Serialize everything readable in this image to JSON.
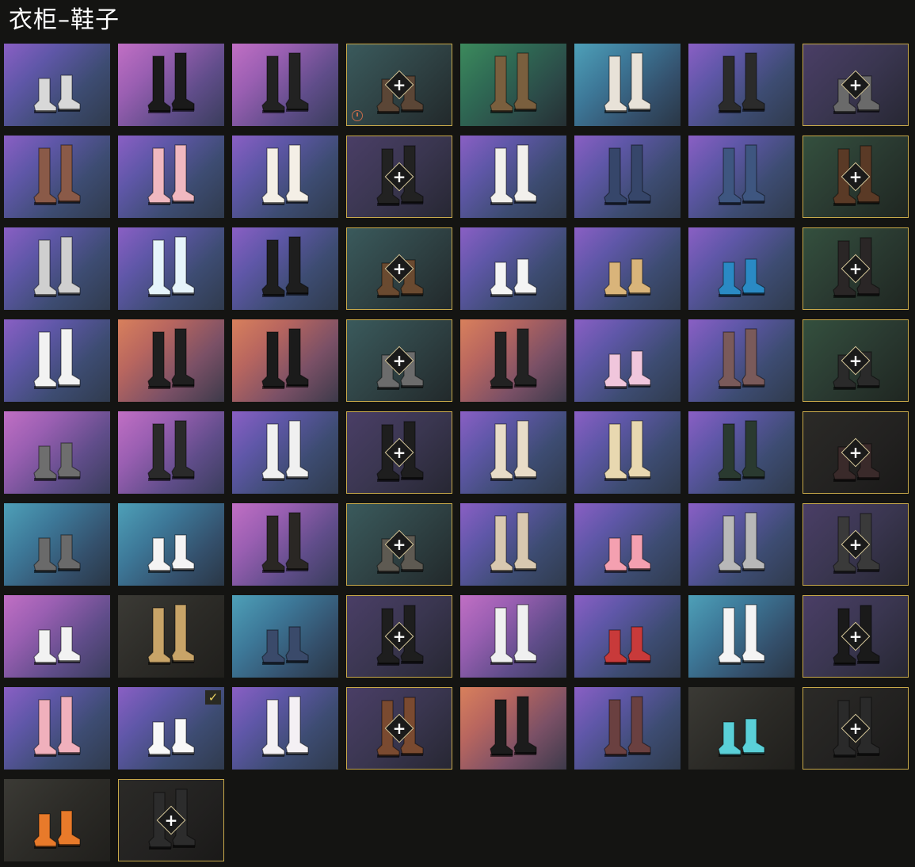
{
  "title": "衣柜–鞋子",
  "colors": {
    "locked_border": "#c8a94a",
    "background": "#141412"
  },
  "items": [
    {
      "bg": "purple",
      "shoe": "sneaker-white-red",
      "shoe_color": "#d8d8d8",
      "locked": false
    },
    {
      "bg": "pink",
      "shoe": "boots-black-yellow",
      "shoe_color": "#1a1a1a",
      "locked": false
    },
    {
      "bg": "pink",
      "shoe": "boots-black-neon",
      "shoe_color": "#222222",
      "locked": false
    },
    {
      "bg": "dim-teal",
      "shoe": "shoes-brown",
      "shoe_color": "#5b4636",
      "locked": true,
      "timed": true
    },
    {
      "bg": "green",
      "shoe": "boots-brown",
      "shoe_color": "#7a5f3e",
      "locked": false
    },
    {
      "bg": "teal",
      "shoe": "socks-loafers",
      "shoe_color": "#e8e2d8",
      "locked": false
    },
    {
      "bg": "purple",
      "shoe": "pants-cyan-shoes",
      "shoe_color": "#2b2b2b",
      "locked": false
    },
    {
      "bg": "dim-purple",
      "shoe": "sneakers-grey",
      "shoe_color": "#6a6a6a",
      "locked": true
    },
    {
      "bg": "purple",
      "shoe": "boots-brown-white",
      "shoe_color": "#8a5a48",
      "locked": false
    },
    {
      "bg": "purple",
      "shoe": "boots-pink-puffy",
      "shoe_color": "#f0b8c0",
      "locked": false
    },
    {
      "bg": "purple",
      "shoe": "socks-cream",
      "shoe_color": "#f4efe6",
      "locked": false
    },
    {
      "bg": "dim-purple",
      "shoe": "boots-black-tall",
      "shoe_color": "#222222",
      "locked": true
    },
    {
      "bg": "purple",
      "shoe": "socks-brown-shoes",
      "shoe_color": "#f2f0ec",
      "locked": false
    },
    {
      "bg": "purple",
      "shoe": "jeans-boots",
      "shoe_color": "#36466a",
      "locked": false
    },
    {
      "bg": "purple",
      "shoe": "jeans-boots",
      "shoe_color": "#3e5680",
      "locked": false
    },
    {
      "bg": "dim-green",
      "shoe": "pants-brown",
      "shoe_color": "#5a3a26",
      "locked": true
    },
    {
      "bg": "purple",
      "shoe": "boots-white-slouch",
      "shoe_color": "#cfcfcf",
      "locked": false
    },
    {
      "bg": "purple",
      "shoe": "boots-ice",
      "shoe_color": "#e6f4fb",
      "locked": false
    },
    {
      "bg": "purple",
      "shoe": "pants-black",
      "shoe_color": "#1e1e1e",
      "locked": false
    },
    {
      "bg": "dim-teal",
      "shoe": "shoes-brown-low",
      "shoe_color": "#6a4a30",
      "locked": true
    },
    {
      "bg": "purple",
      "shoe": "flats-white",
      "shoe_color": "#f4f4f4",
      "locked": false
    },
    {
      "bg": "purple",
      "shoe": "slippers-bear",
      "shoe_color": "#d9b47a",
      "locked": false
    },
    {
      "bg": "purple",
      "shoe": "sneakers-blue-green",
      "shoe_color": "#2a8ac4",
      "locked": false
    },
    {
      "bg": "dim-green",
      "shoe": "boots-dark",
      "shoe_color": "#2a2626",
      "locked": true
    },
    {
      "bg": "purple",
      "shoe": "heels-white-socks",
      "shoe_color": "#f2f2f2",
      "locked": false
    },
    {
      "bg": "orange",
      "shoe": "boots-black-heel",
      "shoe_color": "#1f1f1f",
      "locked": false
    },
    {
      "bg": "orange",
      "shoe": "boots-black-tall",
      "shoe_color": "#1b1b1b",
      "locked": false
    },
    {
      "bg": "dim-teal",
      "shoe": "shoes-grey",
      "shoe_color": "#6c6c6c",
      "locked": true
    },
    {
      "bg": "orange",
      "shoe": "boots-black-strap",
      "shoe_color": "#222222",
      "locked": false
    },
    {
      "bg": "purple",
      "shoe": "sneakers-pink",
      "shoe_color": "#f0c6dc",
      "locked": false
    },
    {
      "bg": "purple",
      "shoe": "stockings-fishnet",
      "shoe_color": "#7a5a5a",
      "locked": false
    },
    {
      "bg": "dim-green",
      "shoe": "sneakers-dark",
      "shoe_color": "#2a2a2a",
      "locked": true
    },
    {
      "bg": "pink",
      "shoe": "sneakers-grey-black",
      "shoe_color": "#6e6e6e",
      "locked": false
    },
    {
      "bg": "pink",
      "shoe": "pants-black-red",
      "shoe_color": "#2a2a2a",
      "locked": false
    },
    {
      "bg": "purple",
      "shoe": "boots-cow",
      "shoe_color": "#f0f0f0",
      "locked": false
    },
    {
      "bg": "dim-purple",
      "shoe": "boots-black-tall",
      "shoe_color": "#1e1e1e",
      "locked": true
    },
    {
      "bg": "purple",
      "shoe": "boots-cream",
      "shoe_color": "#e8dcc8",
      "locked": false
    },
    {
      "bg": "purple",
      "shoe": "boots-beige",
      "shoe_color": "#e8d8b0",
      "locked": false
    },
    {
      "bg": "purple",
      "shoe": "boots-green-black",
      "shoe_color": "#2a3a30",
      "locked": false
    },
    {
      "bg": "dim-dark",
      "shoe": "shoes-dark-red",
      "shoe_color": "#3a2a2a",
      "locked": true
    },
    {
      "bg": "teal",
      "shoe": "paws-grey",
      "shoe_color": "#6a6a6a",
      "locked": false
    },
    {
      "bg": "teal",
      "shoe": "sneakers-white-blue",
      "shoe_color": "#f4f4f4",
      "locked": false
    },
    {
      "bg": "pink",
      "shoe": "boots-black-combat",
      "shoe_color": "#2a2724",
      "locked": false
    },
    {
      "bg": "dim-teal",
      "shoe": "shoes-grey-low",
      "shoe_color": "#5e5a52",
      "locked": true
    },
    {
      "bg": "purple",
      "shoe": "boots-fur-beige",
      "shoe_color": "#d8c8b0",
      "locked": false
    },
    {
      "bg": "purple",
      "shoe": "slippers-pink",
      "shoe_color": "#f4a0b0",
      "locked": false
    },
    {
      "bg": "purple",
      "shoe": "boots-robot",
      "shoe_color": "#b8b8b8",
      "locked": false
    },
    {
      "bg": "dim-purple",
      "shoe": "boots-grey-dark",
      "shoe_color": "#3a3a3a",
      "locked": true
    },
    {
      "bg": "pink",
      "shoe": "sneakers-white-black",
      "shoe_color": "#f2f2f2",
      "locked": false
    },
    {
      "bg": "dark",
      "shoe": "boots-tan",
      "shoe_color": "#c8a468",
      "locked": false
    },
    {
      "bg": "teal",
      "shoe": "sneakers-navy",
      "shoe_color": "#3a4a6a",
      "locked": false
    },
    {
      "bg": "dim-purple",
      "shoe": "boots-black-low",
      "shoe_color": "#1e1e1e",
      "locked": true
    },
    {
      "bg": "pink",
      "shoe": "boots-white-lace",
      "shoe_color": "#f0f0f0",
      "locked": false
    },
    {
      "bg": "purple",
      "shoe": "sneakers-red-white",
      "shoe_color": "#c83a3a",
      "locked": false
    },
    {
      "bg": "teal",
      "shoe": "socks-red-shoes",
      "shoe_color": "#f4f4f4",
      "locked": false
    },
    {
      "bg": "dim-purple",
      "shoe": "boots-black-chunky",
      "shoe_color": "#1a1a1a",
      "locked": true
    },
    {
      "bg": "purple",
      "shoe": "boots-pink-slouch",
      "shoe_color": "#f0b0bc",
      "locked": false
    },
    {
      "bg": "purple",
      "shoe": "paws-white",
      "shoe_color": "#f8f8f8",
      "locked": false,
      "selected": true
    },
    {
      "bg": "purple",
      "shoe": "stockings-ballet",
      "shoe_color": "#f4f0f4",
      "locked": false
    },
    {
      "bg": "dim-purple",
      "shoe": "boots-brown-tall",
      "shoe_color": "#7a4a30",
      "locked": true
    },
    {
      "bg": "orange",
      "shoe": "boots-thigh-black",
      "shoe_color": "#1c1c1c",
      "locked": false
    },
    {
      "bg": "purple",
      "shoe": "stockings-lace",
      "shoe_color": "#6a4040",
      "locked": false
    },
    {
      "bg": "dark",
      "shoe": "clogs-cyan",
      "shoe_color": "#5ad0d8",
      "locked": false
    },
    {
      "bg": "dim-dark",
      "shoe": "boots-fur-black",
      "shoe_color": "#2a2a2a",
      "locked": true
    },
    {
      "bg": "dark",
      "shoe": "sneakers-orange",
      "shoe_color": "#e87a2a",
      "locked": false
    },
    {
      "bg": "dim-dark",
      "shoe": "boots-grey-black",
      "shoe_color": "#2c2c2c",
      "locked": true
    }
  ]
}
